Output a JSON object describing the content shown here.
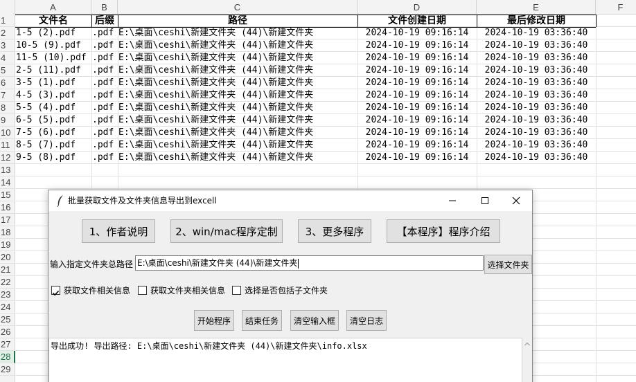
{
  "spreadsheet": {
    "column_letters": [
      "A",
      "B",
      "C",
      "D",
      "E",
      "F"
    ],
    "row_numbers": [
      "1",
      "2",
      "3",
      "4",
      "5",
      "6",
      "7",
      "8",
      "9",
      "10",
      "11",
      "12",
      "13",
      "14",
      "15",
      "16",
      "17",
      "18",
      "19",
      "20",
      "21",
      "22",
      "23",
      "24",
      "25",
      "26",
      "27",
      "28",
      "29"
    ],
    "active_row": "28",
    "headers": [
      "文件名",
      "后缀",
      "路径",
      "文件创建日期",
      "最后修改日期"
    ],
    "rows": [
      [
        "1-5 (2).pdf",
        ".pdf",
        "E:\\桌面\\ceshi\\新建文件夹 (44)\\新建文件夹",
        "2024-10-19 09:16:14",
        "2024-10-19 03:36:40"
      ],
      [
        "10-5 (9).pdf",
        ".pdf",
        "E:\\桌面\\ceshi\\新建文件夹 (44)\\新建文件夹",
        "2024-10-19 09:16:14",
        "2024-10-19 03:36:40"
      ],
      [
        "11-5 (10).pdf",
        ".pdf",
        "E:\\桌面\\ceshi\\新建文件夹 (44)\\新建文件夹",
        "2024-10-19 09:16:14",
        "2024-10-19 03:36:40"
      ],
      [
        "2-5 (11).pdf",
        ".pdf",
        "E:\\桌面\\ceshi\\新建文件夹 (44)\\新建文件夹",
        "2024-10-19 09:16:14",
        "2024-10-19 03:36:40"
      ],
      [
        "3-5 (1).pdf",
        ".pdf",
        "E:\\桌面\\ceshi\\新建文件夹 (44)\\新建文件夹",
        "2024-10-19 09:16:14",
        "2024-10-19 03:36:40"
      ],
      [
        "4-5 (3).pdf",
        ".pdf",
        "E:\\桌面\\ceshi\\新建文件夹 (44)\\新建文件夹",
        "2024-10-19 09:16:14",
        "2024-10-19 03:36:40"
      ],
      [
        "5-5 (4).pdf",
        ".pdf",
        "E:\\桌面\\ceshi\\新建文件夹 (44)\\新建文件夹",
        "2024-10-19 09:16:14",
        "2024-10-19 03:36:40"
      ],
      [
        "6-5 (5).pdf",
        ".pdf",
        "E:\\桌面\\ceshi\\新建文件夹 (44)\\新建文件夹",
        "2024-10-19 09:16:14",
        "2024-10-19 03:36:40"
      ],
      [
        "7-5 (6).pdf",
        ".pdf",
        "E:\\桌面\\ceshi\\新建文件夹 (44)\\新建文件夹",
        "2024-10-19 09:16:14",
        "2024-10-19 03:36:40"
      ],
      [
        "8-5 (7).pdf",
        ".pdf",
        "E:\\桌面\\ceshi\\新建文件夹 (44)\\新建文件夹",
        "2024-10-19 09:16:14",
        "2024-10-19 03:36:40"
      ],
      [
        "9-5 (8).pdf",
        ".pdf",
        "E:\\桌面\\ceshi\\新建文件夹 (44)\\新建文件夹",
        "2024-10-19 09:16:14",
        "2024-10-19 03:36:40"
      ]
    ]
  },
  "dialog": {
    "title": "批量获取文件及文件夹信息导出到excell",
    "title_icon": "feather-icon",
    "top_buttons": [
      "1、作者说明",
      "2、win/mac程序定制",
      "3、更多程序",
      "【本程序】程序介绍"
    ],
    "path_label": "输入指定文件夹总路径",
    "path_value": "E:\\桌面\\ceshi\\新建文件夹 (44)\\新建文件夹",
    "choose_button": "选择文件夹",
    "checkboxes": [
      {
        "label": "获取文件相关信息",
        "checked": true
      },
      {
        "label": "获取文件夹相关信息",
        "checked": false
      },
      {
        "label": "选择是否包括子文件夹",
        "checked": false
      }
    ],
    "action_buttons": [
      "开始程序",
      "结束任务",
      "清空输入框",
      "清空日志"
    ],
    "log_text": "导出成功! 导出路径: E:\\桌面\\ceshi\\新建文件夹 (44)\\新建文件夹\\info.xlsx"
  },
  "colors": {
    "accent_green": "#1e7145",
    "button_bg": "#e1e1e1",
    "dialog_bg": "#f0f0f0"
  }
}
